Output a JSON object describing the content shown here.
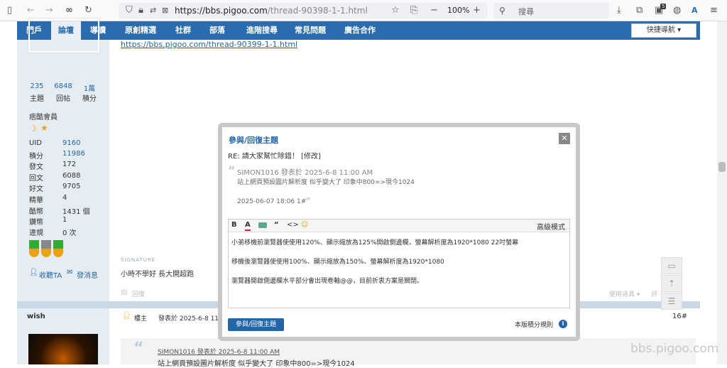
{
  "browser": {
    "url_host": "https://bbs.pigoo.com",
    "url_path": "/thread-90398-1-1.html",
    "zoom": "100%",
    "search_placeholder": "搜尋",
    "badge_count": "5"
  },
  "nav": {
    "items": [
      "門戶",
      "論壇",
      "導讀",
      "原創精選",
      "社群",
      "部落",
      "進階搜尋",
      "常見問題",
      "廣告合作"
    ],
    "quick_nav": "快捷導航 ▾"
  },
  "post1": {
    "link": "https://bbs.pigoo.com/thread-90399-1-1.html",
    "stats": [
      {
        "value": "235",
        "label": "主題"
      },
      {
        "value": "6848",
        "label": "回帖"
      },
      {
        "value": "1萬",
        "label": "積分"
      }
    ],
    "rank": "痞酷會員",
    "info": [
      {
        "label": "UID",
        "value": "9160",
        "link": true
      },
      {
        "label": "積分",
        "value": "11986",
        "link": true
      },
      {
        "label": "發文",
        "value": "172",
        "link": false
      },
      {
        "label": "回文",
        "value": "6088",
        "link": false
      },
      {
        "label": "好文",
        "value": "9705",
        "link": false
      },
      {
        "label": "精華",
        "value": "4",
        "link": false
      },
      {
        "label": "酷幣",
        "value": "1431 個",
        "link": false
      },
      {
        "label": "鑽幣",
        "value": "1",
        "link": false
      },
      {
        "label": "違規",
        "value": "0 次",
        "link": false
      }
    ],
    "collect_ta": "收聽TA",
    "send_msg": "發消息",
    "signature_label": "SIGNATURE",
    "signature": "小時不學好 長大開超跑",
    "reply": "回復",
    "tools": "使用道具 ▾",
    "rate": "評"
  },
  "post2": {
    "author": "wish",
    "role": "樓主",
    "posted": "發表於 2025-6-8 11:",
    "floor": "16#",
    "quote_by": "SIMON1016 發表於 2025-6-8 11:00 AM",
    "quote_text": "站上網頁預設圖片解析度 似乎變大了 印象中800=>現今1024"
  },
  "dialog": {
    "title": "參與/回復主題",
    "subject": "RE: 請大家幫忙除錯！ [修改]",
    "quote_by": "SIMON1016 發表於 2025-6-8 11:00 AM",
    "quote_text": "站上網頁預設圖片解析度 似乎變大了 印象中800=>現今1024",
    "quote_date": "2025-06-07 18:06  1#",
    "advanced_mode": "高級模式",
    "toolbar": {
      "bold": "B",
      "font_color": "A",
      "quote": "“",
      "code": "<>",
      "emoji": "☺"
    },
    "editor_lines": [
      "小弟移機前瀏覽器使使用120%、顯示縮放為125%開啟側邊欄，螢幕解析度為1920*1080 22吋螢幕",
      "移機後瀏覽器使使用100%、顯示縮放為150%、螢幕解析度為1920*1080",
      "瀏覽器開啟側邊欄水平部分會出現卷軸@@，目前折衷方案是關閉。"
    ],
    "submit": "參與/回復主題",
    "rules": "本版積分規則"
  },
  "watermark": "bbs.pigoo.com"
}
